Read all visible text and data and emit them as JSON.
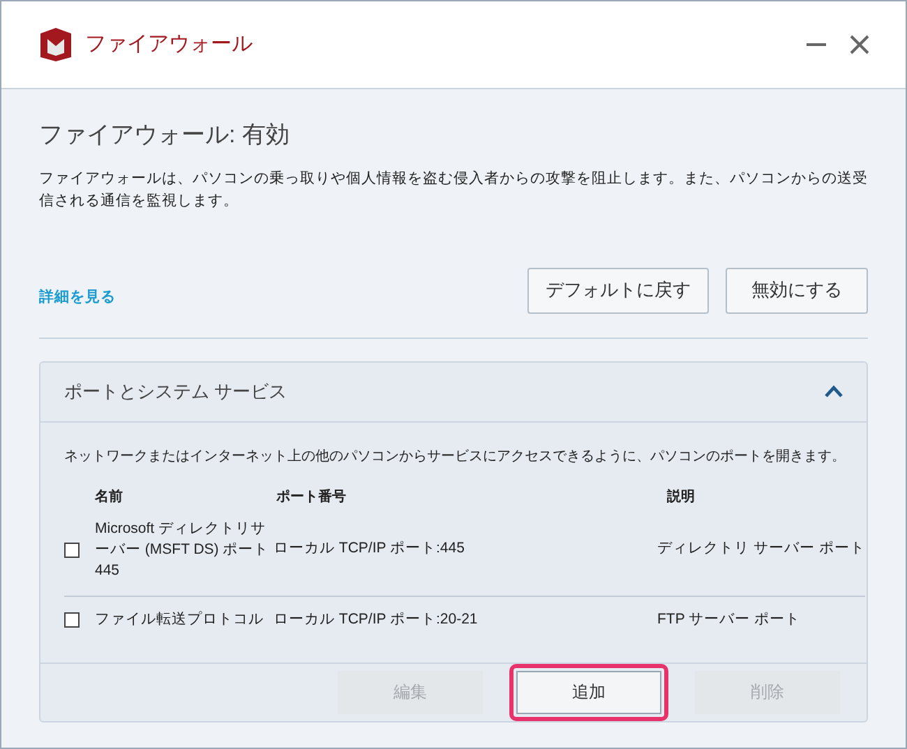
{
  "window": {
    "title": "ファイアウォール"
  },
  "status": {
    "title": "ファイアウォール: 有効",
    "description": "ファイアウォールは、パソコンの乗っ取りや個人情報を盗む侵入者からの攻撃を阻止します。また、パソコンからの送受信される通信を監視します。"
  },
  "details_link": "詳細を見る",
  "actions": [
    {
      "label": "デフォルトに戻す"
    },
    {
      "label": "無効にする"
    }
  ],
  "panel": {
    "title": "ポートとシステム サービス",
    "expanded": true,
    "description": "ネットワークまたはインターネット上の他のパソコンからサービスにアクセスできるように、パソコンのポートを開きます。",
    "columns": [
      "名前",
      "ポート番号",
      "説明"
    ],
    "rows": [
      {
        "name": "Microsoft ディレクトリサーバー (MSFT DS) ポート 445",
        "port": "ローカル TCP/IP ポート:445",
        "description": "ディレクトリ サーバー ポート",
        "checked": false
      },
      {
        "name": "ファイル転送プロトコル",
        "port": "ローカル TCP/IP ポート:20-21",
        "description": "FTP サーバー ポート",
        "checked": false
      }
    ],
    "buttons": [
      {
        "label": "編集",
        "disabled": true,
        "highlighted": false
      },
      {
        "label": "追加",
        "disabled": false,
        "highlighted": true
      },
      {
        "label": "削除",
        "disabled": true,
        "highlighted": false
      }
    ]
  }
}
